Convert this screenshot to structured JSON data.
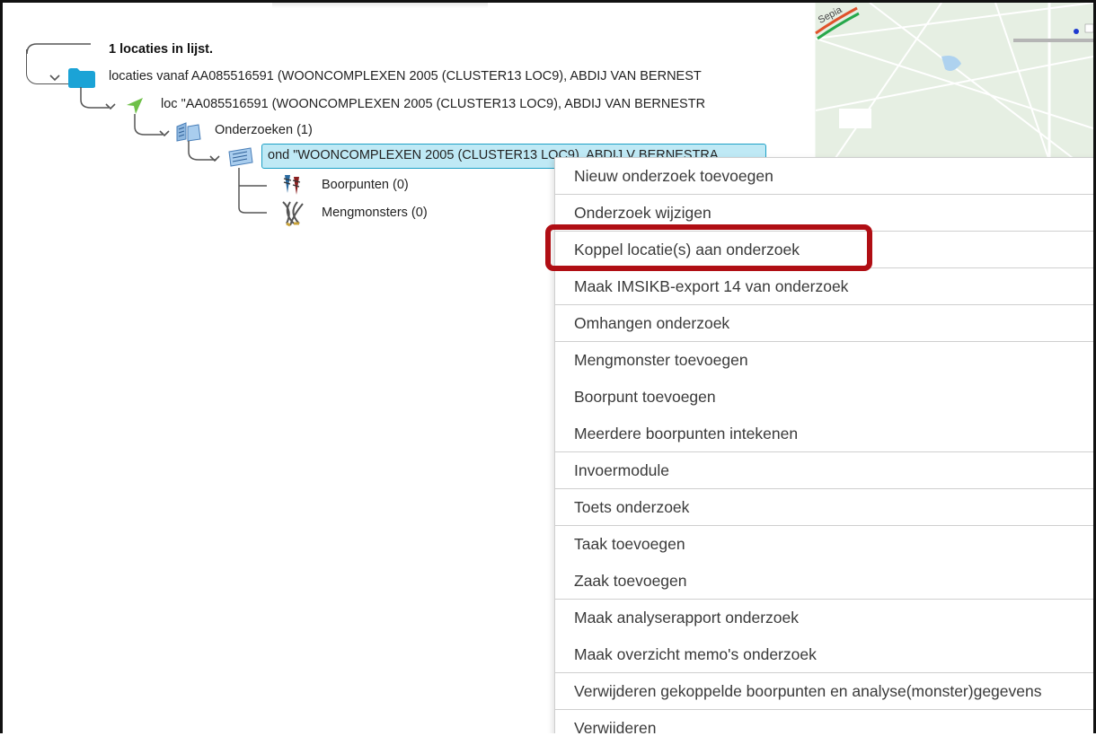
{
  "tree": {
    "header": "1 locaties in lijst.",
    "folder_label": "locaties vanaf AA085516591 (WOONCOMPLEXEN 2005 (CLUSTER13 LOC9), ABDIJ VAN BERNEST",
    "location_label": "loc \"AA085516591 (WOONCOMPLEXEN 2005 (CLUSTER13 LOC9), ABDIJ VAN BERNESTR",
    "investigations_label": "Onderzoeken (1)",
    "selected_label": "ond \"WOONCOMPLEXEN 2005 (CLUSTER13 LOC9), ABDIJ V BERNESTRA",
    "children": [
      {
        "label": "Boorpunten (0)"
      },
      {
        "label": "Mengmonsters (0)"
      }
    ]
  },
  "map": {
    "label_fragment": "Sepia"
  },
  "context_menu": {
    "items": [
      {
        "label": "Nieuw onderzoek toevoegen"
      },
      {
        "label": "Onderzoek wijzigen"
      },
      {
        "label": "Koppel locatie(s) aan onderzoek",
        "highlighted": true
      },
      {
        "label": "Maak IMSIKB-export 14 van onderzoek"
      },
      {
        "label": "Omhangen onderzoek"
      },
      {
        "label": "Mengmonster toevoegen"
      },
      {
        "label": "Boorpunt toevoegen"
      },
      {
        "label": "Meerdere boorpunten intekenen"
      },
      {
        "label": "Invoermodule"
      },
      {
        "label": "Toets onderzoek"
      },
      {
        "label": "Taak toevoegen"
      },
      {
        "label": "Zaak toevoegen"
      },
      {
        "label": "Maak analyserapport onderzoek"
      },
      {
        "label": "Maak overzicht memo's onderzoek"
      },
      {
        "label": "Verwijderen gekoppelde boorpunten en analyse(monster)gegevens"
      },
      {
        "label": "Verwijderen"
      }
    ]
  },
  "colors": {
    "highlight_border": "#b00e14",
    "selection_bg": "#bfe9f5",
    "selection_border": "#1ea0c6",
    "folder_icon": "#1ba3d6",
    "location_icon": "#6ec048"
  }
}
